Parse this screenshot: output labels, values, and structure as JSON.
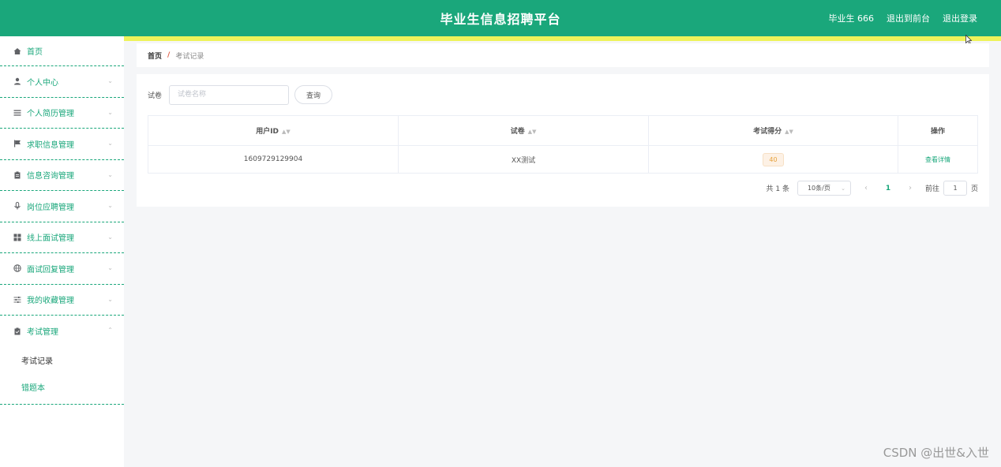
{
  "header": {
    "title": "毕业生信息招聘平台",
    "user": "毕业生 666",
    "to_front": "退出到前台",
    "logout": "退出登录"
  },
  "sidebar": {
    "items": [
      {
        "label": "首页",
        "icon": "home-icon"
      },
      {
        "label": "个人中心",
        "icon": "user-icon"
      },
      {
        "label": "个人简历管理",
        "icon": "list-icon"
      },
      {
        "label": "求职信息管理",
        "icon": "flag-icon"
      },
      {
        "label": "信息咨询管理",
        "icon": "clipboard-icon"
      },
      {
        "label": "岗位应聘管理",
        "icon": "mic-icon"
      },
      {
        "label": "线上面试管理",
        "icon": "grid-icon"
      },
      {
        "label": "面试回复管理",
        "icon": "globe-icon"
      },
      {
        "label": "我的收藏管理",
        "icon": "sliders-icon"
      },
      {
        "label": "考试管理",
        "icon": "clipboard-check-icon"
      }
    ],
    "sub_items": [
      "考试记录",
      "错题本"
    ]
  },
  "breadcrumb": {
    "home": "首页",
    "sep": "/",
    "current": "考试记录"
  },
  "search": {
    "label": "试卷",
    "placeholder": "试卷名称",
    "button": "查询"
  },
  "table": {
    "headers": [
      "用户ID",
      "试卷",
      "考试得分",
      "操作"
    ],
    "rows": [
      {
        "user_id": "1609729129904",
        "paper": "XX测试",
        "score": "40",
        "action": "查看详情"
      }
    ]
  },
  "pager": {
    "total": "共 1 条",
    "page_size": "10条/页",
    "current_page": "1",
    "goto_label": "前往",
    "goto_value": "1",
    "page_suffix": "页"
  },
  "watermark": "CSDN @出世&入世",
  "colors": {
    "accent": "#1aa77b",
    "strip": "#eef35a"
  }
}
